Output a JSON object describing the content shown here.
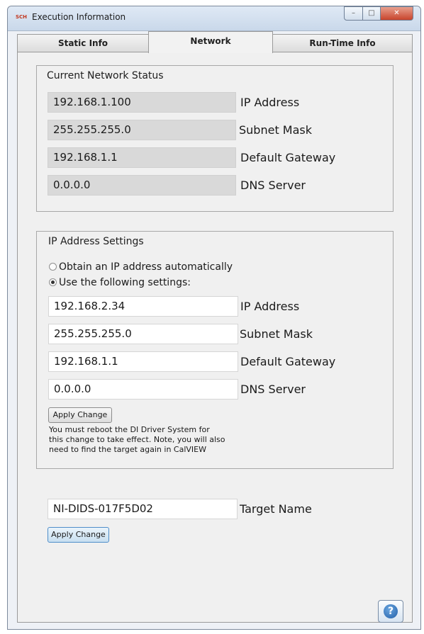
{
  "window": {
    "title": "Execution Information",
    "app_icon_text": "SCH",
    "controls": {
      "minimize": "–",
      "maximize": "□",
      "close": "✕"
    }
  },
  "tabs": [
    {
      "label": "Static Info",
      "active": false
    },
    {
      "label": "Network",
      "active": true
    },
    {
      "label": "Run-Time Info",
      "active": false
    }
  ],
  "current_status": {
    "title": "Current Network Status",
    "rows": [
      {
        "value": "192.168.1.100",
        "label": "IP Address"
      },
      {
        "value": "255.255.255.0",
        "label": "Subnet Mask"
      },
      {
        "value": "192.168.1.1",
        "label": "Default Gateway"
      },
      {
        "value": "0.0.0.0",
        "label": "DNS Server"
      }
    ]
  },
  "ip_settings": {
    "title": "IP Address Settings",
    "radio_auto": {
      "label": "Obtain an IP address automatically",
      "checked": false
    },
    "radio_manual": {
      "label": "Use the following settings:",
      "checked": true
    },
    "rows": [
      {
        "value": "192.168.2.34",
        "label": "IP Address"
      },
      {
        "value": "255.255.255.0",
        "label": "Subnet Mask"
      },
      {
        "value": "192.168.1.1",
        "label": "Default Gateway"
      },
      {
        "value": "0.0.0.0",
        "label": "DNS Server"
      }
    ],
    "apply_label": "Apply Change",
    "note": "You must reboot the DI Driver System for\nthis change to take effect. Note, you will also\nneed to find the target again in CalVIEW"
  },
  "target": {
    "value": "NI-DIDS-017F5D02",
    "label": "Target Name",
    "apply_label": "Apply Change"
  },
  "help": {
    "icon": "help-icon",
    "glyph": "?"
  },
  "colors": {
    "accent": "#2260a8",
    "readonly_field": "#d9d9d9"
  }
}
